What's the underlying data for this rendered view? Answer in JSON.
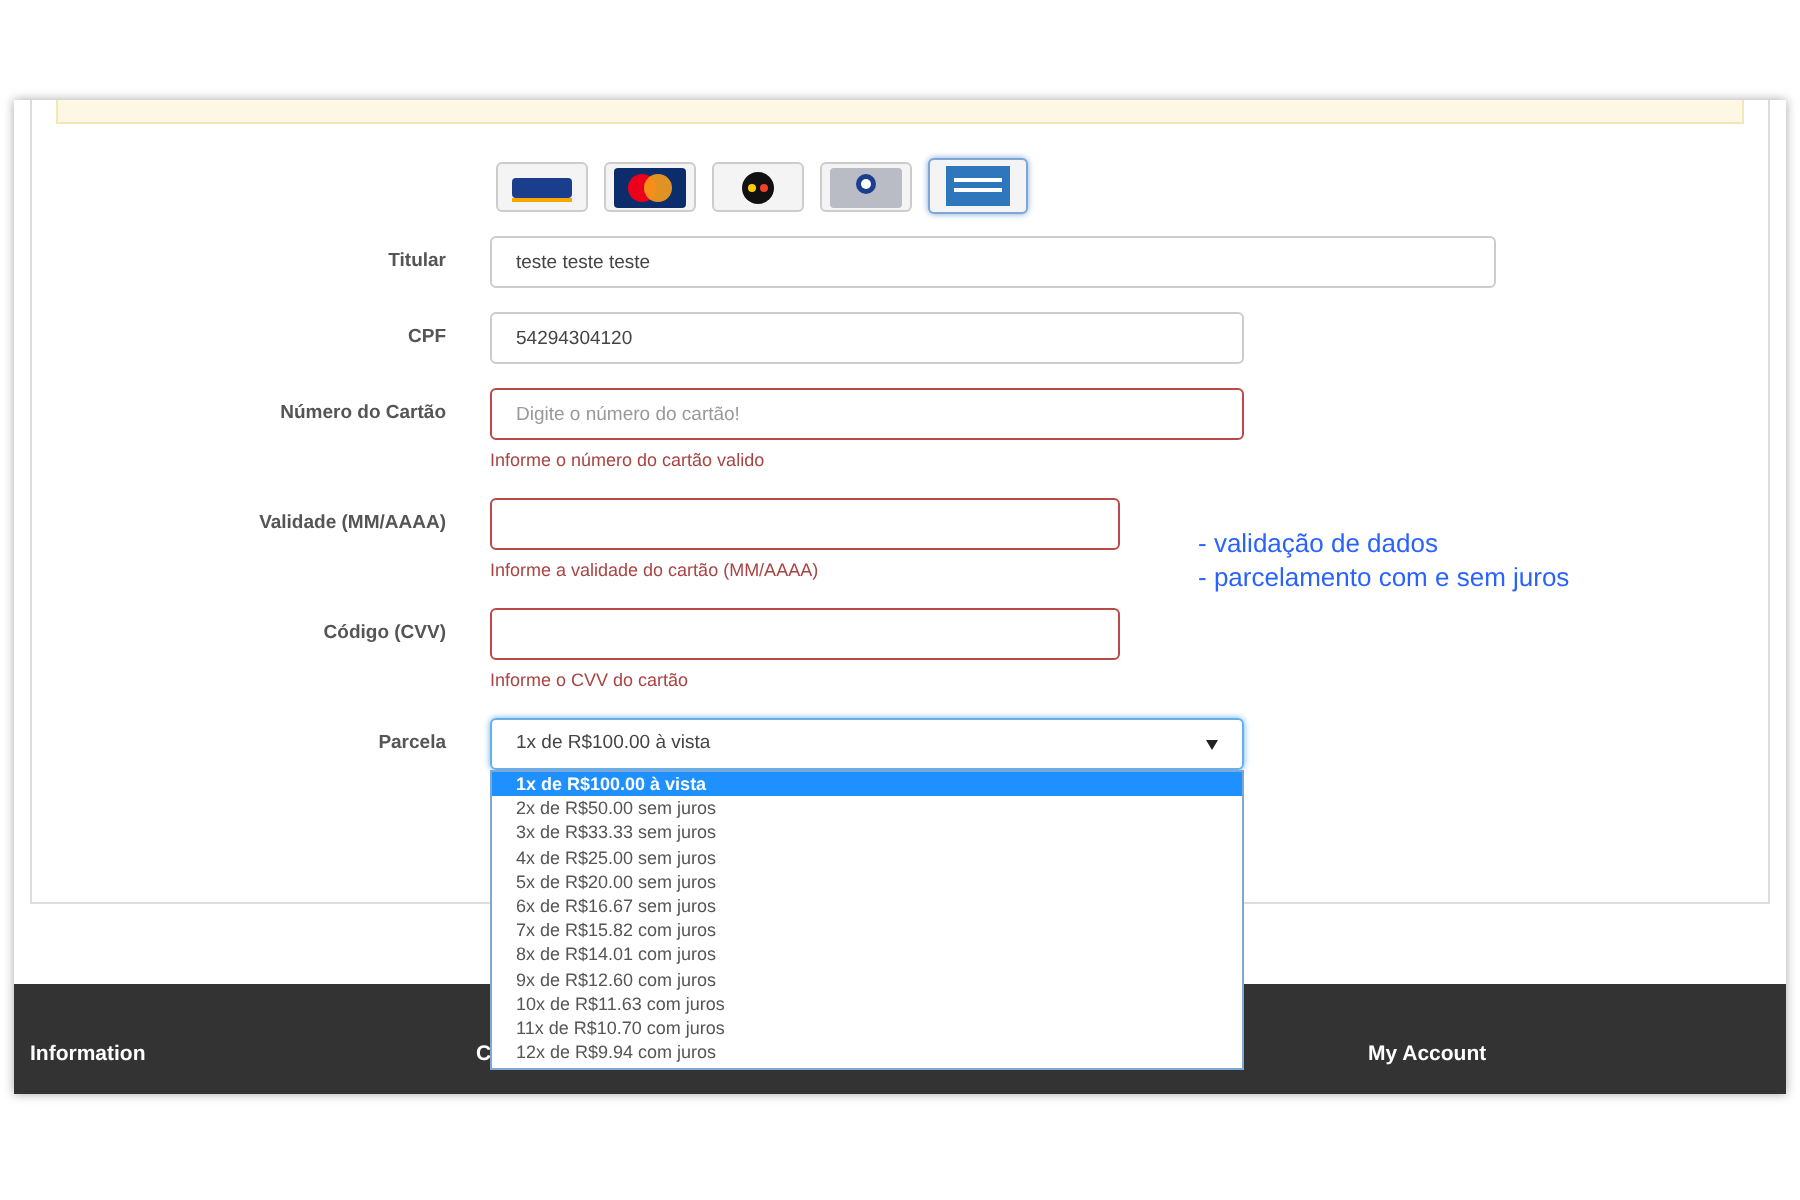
{
  "card_brands": [
    {
      "kind": "visa",
      "selected": false
    },
    {
      "kind": "mastercard",
      "selected": false
    },
    {
      "kind": "elo",
      "selected": false
    },
    {
      "kind": "diners",
      "selected": false
    },
    {
      "kind": "amex",
      "selected": true
    }
  ],
  "fields": [
    {
      "kind": "text",
      "label": "Titular",
      "value": "teste teste teste",
      "invalid": false
    },
    {
      "kind": "text",
      "label": "CPF",
      "value": "54294304120",
      "invalid": false
    },
    {
      "kind": "text",
      "label": "Número do Cartão",
      "placeholder": "Digite o número do cartão!",
      "invalid": true,
      "error": "Informe o número do cartão valido"
    },
    {
      "kind": "text",
      "label": "Validade (MM/AAAA)",
      "invalid": true,
      "error": "Informe a validade do cartão (MM/AAAA)"
    },
    {
      "kind": "text",
      "label": "Código (CVV)",
      "invalid": true,
      "error": "Informe o CVV do cartão"
    },
    {
      "kind": "select",
      "label": "Parcela",
      "value": "1x de R$100.00 à vista",
      "expanded": true,
      "options": [
        {
          "label": "1x de R$100.00 à vista",
          "selected": true
        },
        {
          "label": "2x de R$50.00 sem juros",
          "selected": false
        },
        {
          "label": "3x de R$33.33 sem juros",
          "selected": false
        },
        {
          "label": "4x de R$25.00 sem juros",
          "selected": false
        },
        {
          "label": "5x de R$20.00 sem juros",
          "selected": false
        },
        {
          "label": "6x de R$16.67 sem juros",
          "selected": false
        },
        {
          "label": "7x de R$15.82 com juros",
          "selected": false
        },
        {
          "label": "8x de R$14.01 com juros",
          "selected": false
        },
        {
          "label": "9x de R$12.60 com juros",
          "selected": false
        },
        {
          "label": "10x de R$11.63 com juros",
          "selected": false
        },
        {
          "label": "11x de R$10.70 com juros",
          "selected": false
        },
        {
          "label": "12x de R$9.94 com juros",
          "selected": false
        }
      ]
    }
  ],
  "annotation": [
    "- validação de dados",
    "- parcelamento com e sem juros"
  ],
  "footer": {
    "headings": [
      "Information",
      "C",
      "My Account"
    ]
  }
}
